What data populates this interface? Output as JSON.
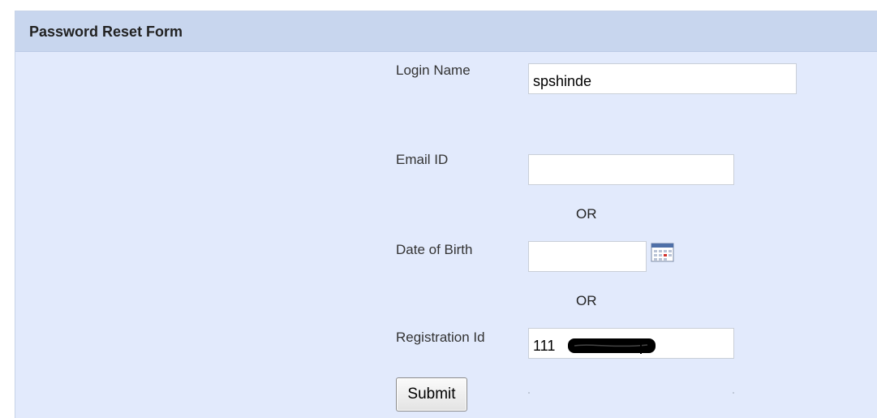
{
  "form": {
    "title": "Password Reset Form",
    "login_name": {
      "label": "Login Name",
      "value": "spshinde"
    },
    "email": {
      "label": "Email ID",
      "value": ""
    },
    "or_1": "OR",
    "dob": {
      "label": "Date of Birth",
      "value": "",
      "icon": "calendar-icon"
    },
    "or_2": "OR",
    "registration_id": {
      "label": "Registration Id",
      "value": "111"
    },
    "submit_label": "Submit"
  },
  "colors": {
    "panel_background": "#e2eafc",
    "header_background": "#c8d6ee",
    "text": "#333333"
  }
}
